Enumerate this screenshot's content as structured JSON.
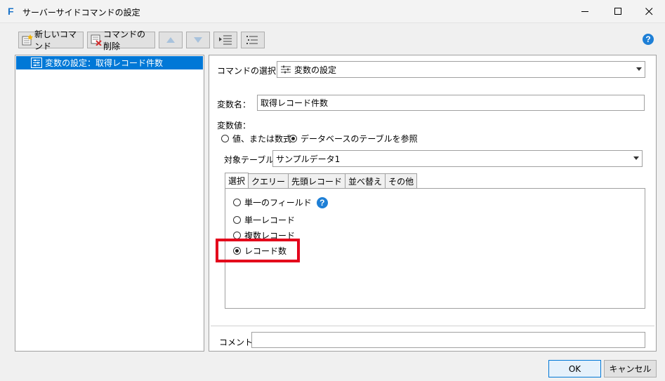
{
  "window": {
    "title": "サーバーサイドコマンドの設定",
    "app_icon": "F"
  },
  "toolbar": {
    "new_command": "新しいコマンド",
    "delete_command": "コマンドの削除",
    "help": "?"
  },
  "tree": {
    "items": [
      {
        "label": "変数の設定：取得レコード件数",
        "selected": true
      }
    ]
  },
  "command_select": {
    "label": "コマンドの選択：",
    "value": "変数の設定"
  },
  "variable_name": {
    "label": "変数名：",
    "value": "取得レコード件数"
  },
  "variable_value": {
    "label": "変数値：",
    "options": [
      {
        "label": "値、または数式",
        "selected": false
      },
      {
        "label": "データベースのテーブルを参照",
        "selected": true
      }
    ]
  },
  "target_table": {
    "label": "対象テーブル：",
    "value": "サンプルデータ1"
  },
  "tabs": [
    {
      "label": "選択",
      "active": true
    },
    {
      "label": "クエリー",
      "active": false
    },
    {
      "label": "先頭レコード",
      "active": false
    },
    {
      "label": "並べ替え",
      "active": false
    },
    {
      "label": "その他",
      "active": false
    }
  ],
  "select_options": [
    {
      "label": "単一のフィールド",
      "selected": false,
      "help": "?"
    },
    {
      "label": "単一レコード",
      "selected": false
    },
    {
      "label": "複数レコード",
      "selected": false
    },
    {
      "label": "レコード数",
      "selected": true
    }
  ],
  "comment": {
    "label": "コメント",
    "value": ""
  },
  "buttons": {
    "ok": "OK",
    "cancel": "キャンセル"
  },
  "colors": {
    "selection": "#0078d7",
    "highlight_box": "#e3001b",
    "help_icon": "#1e7fd6"
  }
}
